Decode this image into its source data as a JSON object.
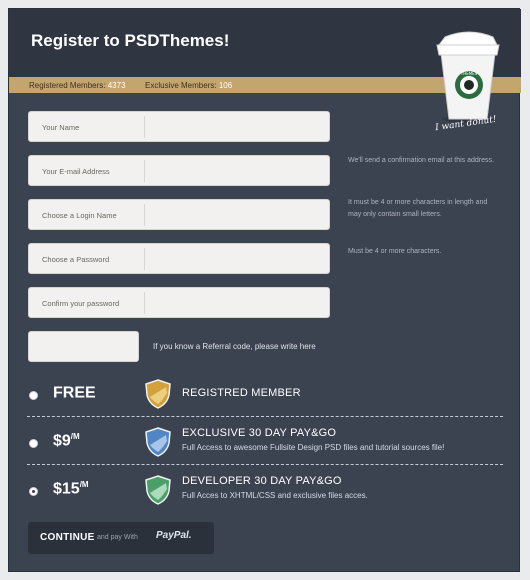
{
  "header": {
    "title": "Register to PSDThemes!",
    "registered_label": "Registered Members:",
    "registered_count": "4373",
    "exclusive_label": "Exclusive Members:",
    "exclusive_count": "106"
  },
  "cup": {
    "note": "I want donut!",
    "logo_text": "THEMES"
  },
  "form": {
    "fields": [
      {
        "label": "Your Name"
      },
      {
        "label": "Your E-mail Address",
        "hint": "We'll send a confirmation email at this address."
      },
      {
        "label": "Choose a Login Name",
        "hint": "It must be 4 or more characters in length and may only contain small letters."
      },
      {
        "label": "Choose a Password",
        "hint": "Must be 4 or more characters."
      },
      {
        "label": "Confirm your password"
      }
    ],
    "referral_note": "If you know a Referral code, please write here"
  },
  "plans": [
    {
      "price": "FREE",
      "suffix": "",
      "name": "REGISTRED MEMBER",
      "desc": "",
      "selected": false,
      "badge_color": "#d3a13a"
    },
    {
      "price": "$9",
      "suffix": "/M",
      "name": "EXCLUSIVE 30 DAY PAY&GO",
      "desc": "Full Access to awesome Fullsite Design PSD files and tutorial sources file!",
      "selected": false,
      "badge_color": "#4f86c6"
    },
    {
      "price": "$15",
      "suffix": "/M",
      "name": "DEVELOPER 30 DAY PAY&GO",
      "desc": "Full Acces to XHTML/CSS and exclusive files acces.",
      "selected": true,
      "badge_color": "#4ba06a"
    }
  ],
  "cta": {
    "continue_label": "CONTINUE",
    "pay_with": "and pay With",
    "paypal": "PayPal."
  },
  "colors": {
    "panel": "#3b4350",
    "header": "#2f3641",
    "stats_bar": "#c3a56e"
  }
}
